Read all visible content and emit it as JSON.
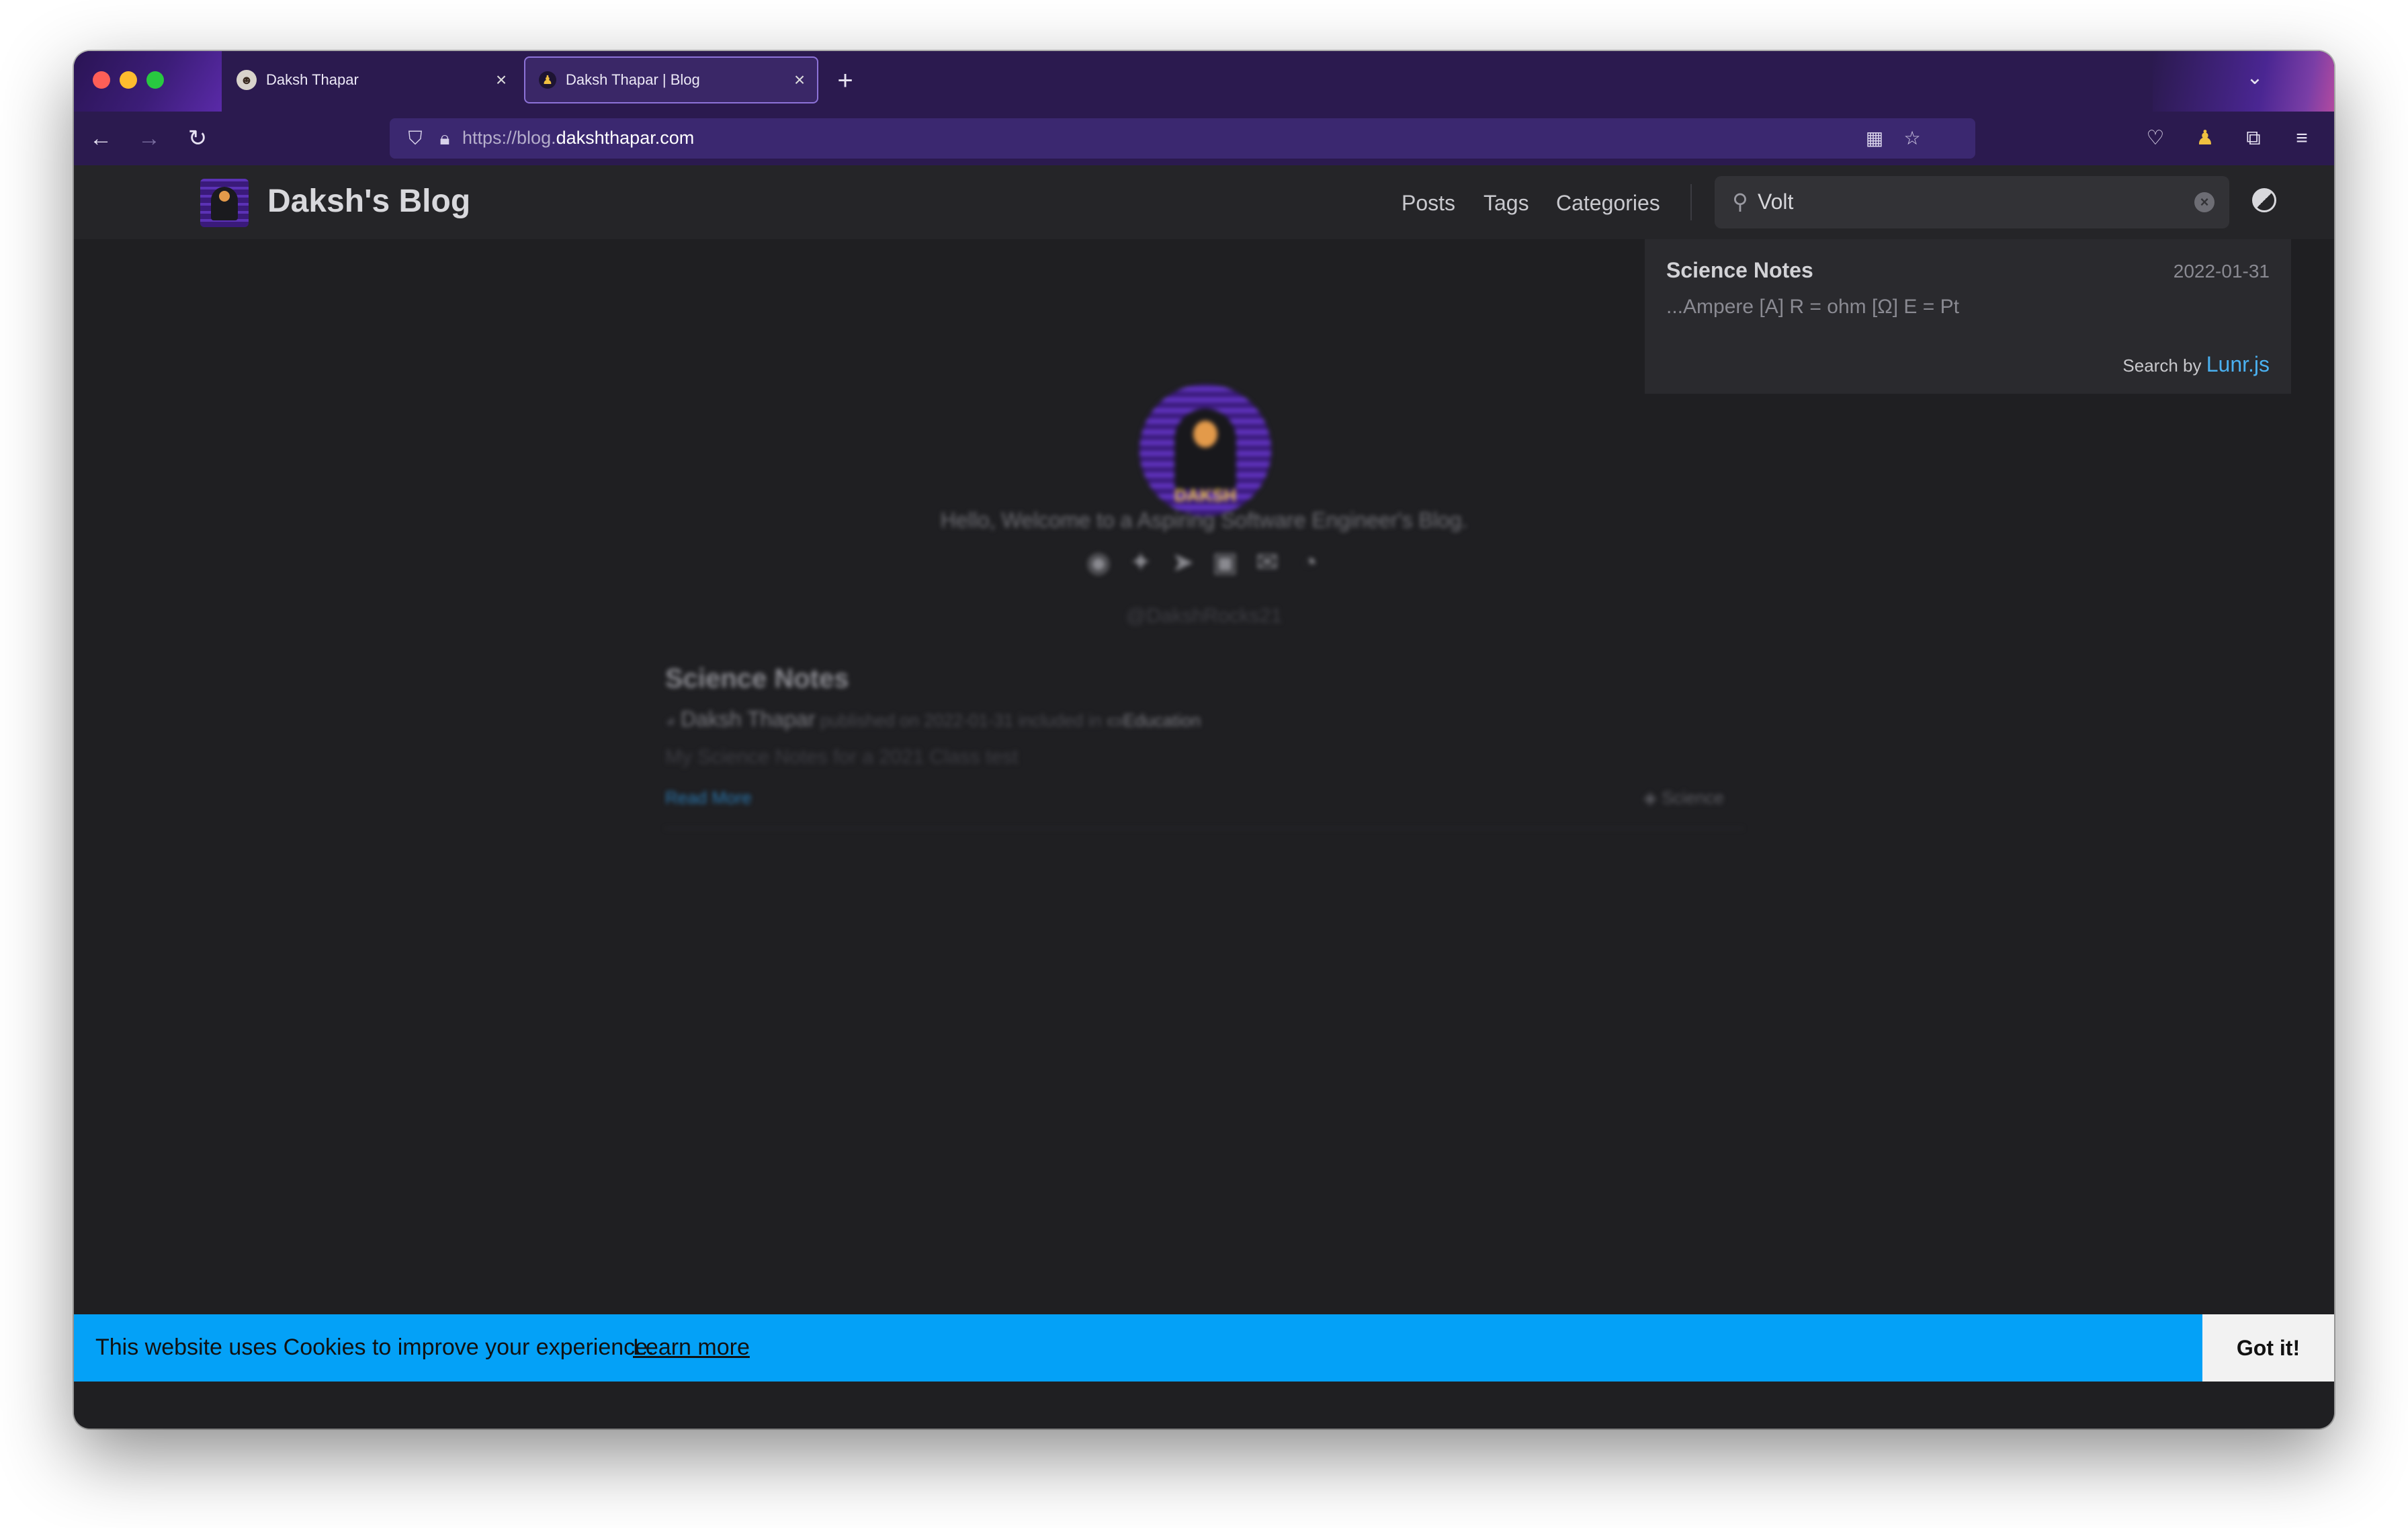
{
  "browser": {
    "tabs": [
      {
        "title": "Daksh Thapar",
        "active": false
      },
      {
        "title": "Daksh Thapar | Blog",
        "active": true
      }
    ],
    "new_tab": "+",
    "url_prefix": "https://blog.",
    "url_host": "dakshthapar.com",
    "icons": [
      "back-icon",
      "forward-icon",
      "reload-icon",
      "shield-icon",
      "lock-icon",
      "qr-code-icon",
      "bookmark-star-icon",
      "pocket-icon",
      "profile-icon",
      "extensions-icon",
      "menu-icon"
    ],
    "accent": "#2b1a4f"
  },
  "site": {
    "title": "Daksh's Blog",
    "nav": [
      "Posts",
      "Tags",
      "Categories"
    ],
    "search": {
      "value": "Volt",
      "placeholder": ""
    },
    "search_results": {
      "items": [
        {
          "title": "Science Notes",
          "date": "2022-01-31",
          "snippet": "...Ampere [A] R = ohm [Ω] E = Pt"
        }
      ],
      "footer_prefix": "Search by ",
      "footer_link": "Lunr.js"
    }
  },
  "profile": {
    "avatar_text": "DAKSH",
    "subtitle": "Hello, Welcome to a Aspiring Software Engineer's Blog.",
    "socials": [
      "github-icon",
      "twitter-icon",
      "telegram-icon",
      "twitch-icon",
      "email-icon",
      "rss-icon"
    ],
    "handle": "@DakshRocks21"
  },
  "posts": [
    {
      "title": "Science Notes",
      "author": "Daksh Thapar",
      "published": "published on 2022-01-31 included in",
      "category": "Education",
      "description": "My Science Notes for a 2021 Class test",
      "read_more": "Read More",
      "tag": "Science"
    }
  ],
  "cookie": {
    "message": "This website uses Cookies to improve your experience.",
    "learn_more": "Learn more",
    "button": "Got it!",
    "color": "#04a1f7"
  }
}
